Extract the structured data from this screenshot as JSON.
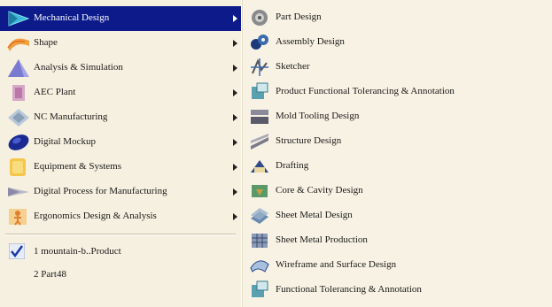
{
  "main_menu": {
    "items": [
      {
        "label": "Mechanical Design",
        "icon": "mechanical-design-icon",
        "submenu": true,
        "highlighted": true
      },
      {
        "label": "Shape",
        "icon": "shape-icon",
        "submenu": true
      },
      {
        "label": "Analysis & Simulation",
        "icon": "analysis-simulation-icon",
        "submenu": true
      },
      {
        "label": "AEC Plant",
        "icon": "aec-plant-icon",
        "submenu": true
      },
      {
        "label": "NC Manufacturing",
        "icon": "nc-manufacturing-icon",
        "submenu": true
      },
      {
        "label": "Digital Mockup",
        "icon": "digital-mockup-icon",
        "submenu": true
      },
      {
        "label": "Equipment & Systems",
        "icon": "equipment-systems-icon",
        "submenu": true
      },
      {
        "label": "Digital Process for Manufacturing",
        "icon": "digital-process-icon",
        "submenu": true
      },
      {
        "label": "Ergonomics Design & Analysis",
        "icon": "ergonomics-icon",
        "submenu": true
      }
    ],
    "recent": [
      {
        "label": "1 mountain-b..Product",
        "checked": true
      },
      {
        "label": "2 Part48",
        "checked": false
      }
    ]
  },
  "submenu": {
    "items": [
      {
        "label": "Part Design",
        "icon": "part-design-icon"
      },
      {
        "label": "Assembly Design",
        "icon": "assembly-design-icon"
      },
      {
        "label": "Sketcher",
        "icon": "sketcher-icon"
      },
      {
        "label": "Product Functional Tolerancing & Annotation",
        "icon": "product-tolerancing-icon"
      },
      {
        "label": "Mold Tooling Design",
        "icon": "mold-tooling-icon"
      },
      {
        "label": "Structure Design",
        "icon": "structure-design-icon"
      },
      {
        "label": "Drafting",
        "icon": "drafting-icon"
      },
      {
        "label": "Core & Cavity Design",
        "icon": "core-cavity-icon"
      },
      {
        "label": "Sheet Metal Design",
        "icon": "sheet-metal-design-icon"
      },
      {
        "label": "Sheet Metal Production",
        "icon": "sheet-metal-production-icon"
      },
      {
        "label": "Wireframe and Surface Design",
        "icon": "wireframe-surface-icon"
      },
      {
        "label": "Functional Tolerancing & Annotation",
        "icon": "functional-tolerancing-icon"
      }
    ]
  },
  "colors": {
    "highlight": "#0c1a8a",
    "menu_bg": "#f6f0e0"
  }
}
